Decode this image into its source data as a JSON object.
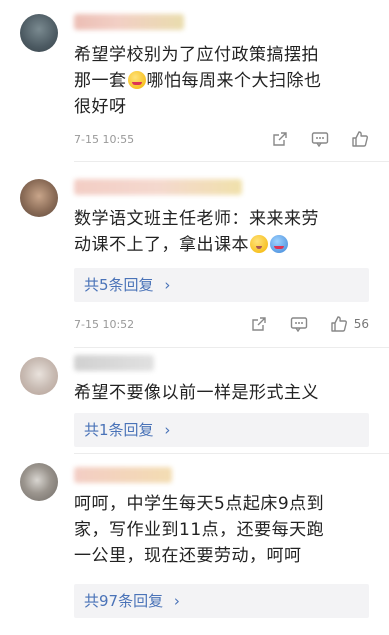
{
  "comments": [
    {
      "text_lines": [
        "希望学校别为了应付政策搞摆拍",
        "那一套",
        "哪怕每周来个大扫除也",
        "很好呀"
      ],
      "time": "7-15 10:55",
      "likes": ""
    },
    {
      "text_lines": [
        "数学语文班主任老师：来来来劳",
        "动课不上了，拿出课本"
      ],
      "replies": "共5条回复",
      "time": "7-15 10:52",
      "likes": "56"
    },
    {
      "text_lines": [
        "希望不要像以前一样是形式主义"
      ],
      "replies": "共1条回复"
    },
    {
      "text_lines": [
        "呵呵，中学生每天5点起床9点到",
        "家，写作业到11点，还要每天跑",
        "一公里，现在还要劳动，呵呵"
      ],
      "replies": "共97条回复"
    }
  ],
  "icons": {
    "share": "share-icon",
    "comment": "comment-icon",
    "like": "thumbs-up-icon",
    "chevron": "chevron-right-icon"
  },
  "colors": {
    "link": "#4a73b8",
    "meta": "#999999",
    "reply_bg": "#f3f3f5"
  }
}
